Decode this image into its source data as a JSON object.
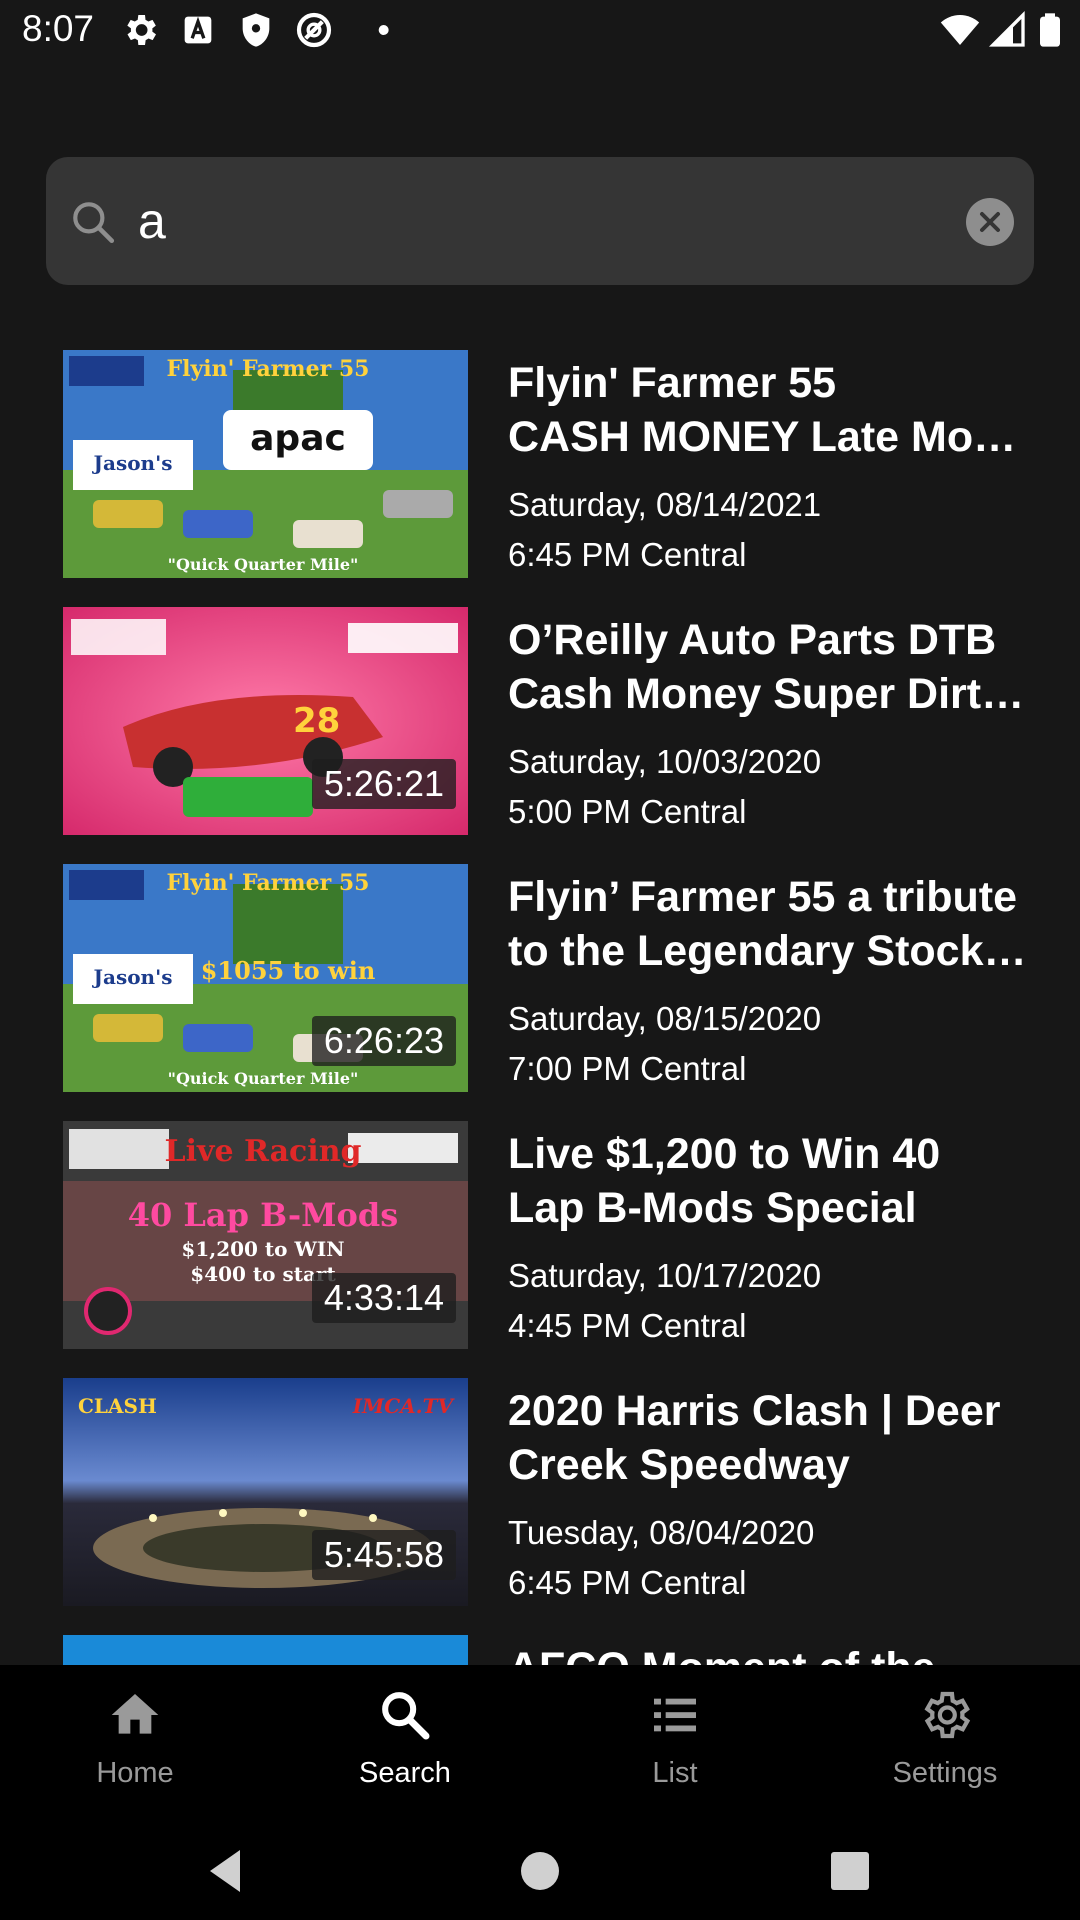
{
  "status_bar": {
    "time": "8:07"
  },
  "search": {
    "query": "a"
  },
  "results": [
    {
      "title_line1": "Flyin' Farmer 55",
      "title_line2": "CASH MONEY Late Mo…",
      "date": "Saturday, 08/14/2021",
      "time": "6:45 PM Central",
      "duration": ""
    },
    {
      "title_line1": "O’Reilly Auto Parts DTB",
      "title_line2": "Cash Money Super Dirt …",
      "date": "Saturday, 10/03/2020",
      "time": "5:00 PM Central",
      "duration": "5:26:21"
    },
    {
      "title_line1": "Flyin’ Farmer 55 a tribute",
      "title_line2": "to the Legendary Stock …",
      "date": "Saturday, 08/15/2020",
      "time": "7:00 PM Central",
      "duration": "6:26:23"
    },
    {
      "title_line1": "Live $1,200 to Win 40",
      "title_line2": "Lap B-Mods Special",
      "date": "Saturday, 10/17/2020",
      "time": "4:45 PM Central",
      "duration": "4:33:14"
    },
    {
      "title_line1": "2020 Harris Clash | Deer",
      "title_line2": "Creek Speedway",
      "date": "Tuesday, 08/04/2020",
      "time": "6:45 PM Central",
      "duration": "5:45:58"
    },
    {
      "title_line1": "AFCO Moment of the",
      "title_line2": "",
      "date": "",
      "time": "",
      "duration": ""
    }
  ],
  "bottom_nav": {
    "items": [
      {
        "label": "Home",
        "icon": "home-icon"
      },
      {
        "label": "Search",
        "icon": "search-icon"
      },
      {
        "label": "List",
        "icon": "list-icon"
      },
      {
        "label": "Settings",
        "icon": "gear-icon"
      }
    ],
    "active": "Search"
  },
  "colors": {
    "background": "#171717",
    "search_field": "#353535",
    "nav_background": "#000000",
    "nav_inactive": "#9a9a9a",
    "nav_active": "#ffffff"
  }
}
